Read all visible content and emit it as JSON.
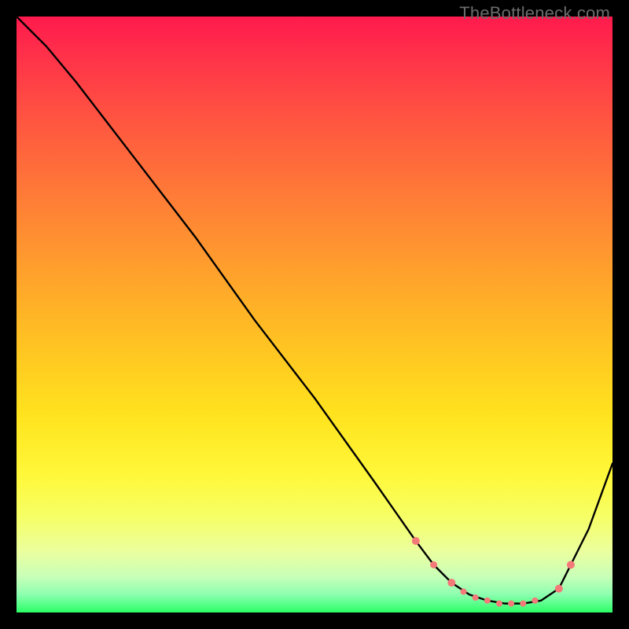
{
  "watermark": "TheBottleneck.com",
  "colors": {
    "curve": "#000000",
    "marker": "#f47a7a",
    "frame": "#000000"
  },
  "chart_data": {
    "type": "line",
    "title": "",
    "xlabel": "",
    "ylabel": "",
    "xlim": [
      0,
      100
    ],
    "ylim": [
      0,
      100
    ],
    "grid": false,
    "legend": false,
    "series": [
      {
        "name": "bottleneck-curve",
        "x": [
          0,
          3,
          5,
          10,
          20,
          30,
          40,
          50,
          60,
          67,
          70,
          73,
          76,
          79,
          82,
          85,
          88,
          91,
          93,
          96,
          100
        ],
        "y": [
          100,
          97,
          95,
          89,
          76,
          63,
          49,
          36,
          22,
          12,
          8,
          5,
          3,
          2,
          1.5,
          1.5,
          2,
          4,
          8,
          14,
          25
        ]
      }
    ],
    "markers": {
      "name": "highlighted-points",
      "x": [
        67,
        70,
        73,
        75,
        77,
        79,
        81,
        83,
        85,
        87,
        91,
        93
      ],
      "y": [
        12,
        8,
        5,
        3.5,
        2.5,
        2,
        1.5,
        1.5,
        1.5,
        2,
        4,
        8
      ],
      "r": [
        5,
        4.5,
        5,
        4,
        4,
        4,
        4,
        4,
        4,
        4,
        5,
        5
      ]
    }
  }
}
